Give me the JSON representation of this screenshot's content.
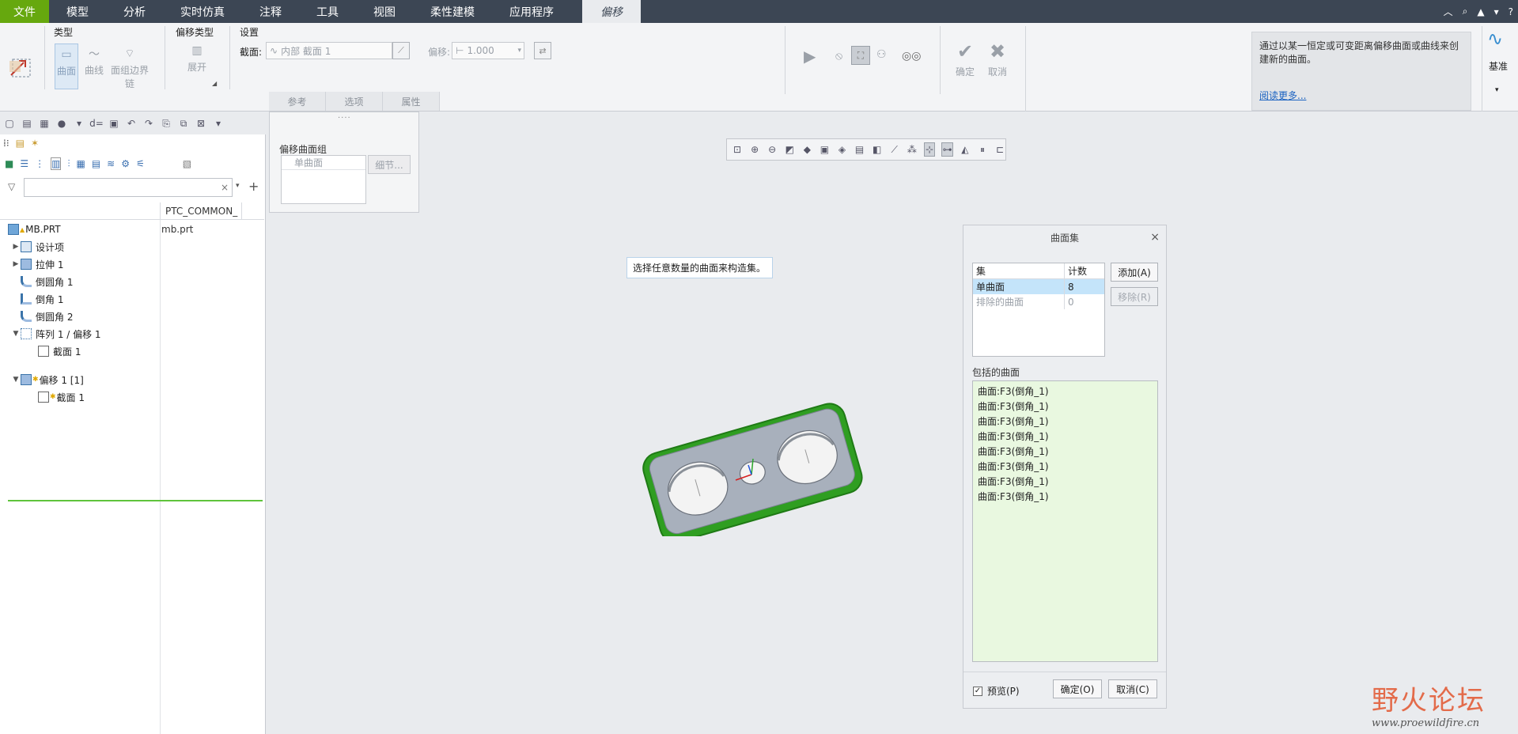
{
  "menubar": {
    "tabs": [
      "文件",
      "模型",
      "分析",
      "实时仿真",
      "注释",
      "工具",
      "视图",
      "柔性建模",
      "应用程序"
    ],
    "active_tab": "偏移",
    "right_icons": [
      "collapse-ribbon-icon",
      "search-icon",
      "graduation-cap-icon",
      "dropdown-icon",
      "help-icon"
    ]
  },
  "ribbon": {
    "type_group": {
      "title": "类型",
      "items": [
        "曲面",
        "曲线",
        "面组边界",
        "链"
      ]
    },
    "offset_type_group": {
      "title": "偏移类型",
      "item": "展开"
    },
    "settings_group": {
      "title": "设置",
      "section_label": "截面:",
      "section_value": "内部 截面 1",
      "offset_label": "偏移:",
      "offset_value": "1.000"
    },
    "subtabs": [
      "参考",
      "选项",
      "属性"
    ],
    "confirm_label": "确定",
    "cancel_label": "取消",
    "info_text": "通过以某一恒定或可变距离偏移曲面或曲线来创建新的曲面。",
    "info_link": "阅读更多...",
    "datum_label": "基准"
  },
  "offset_popover": {
    "title": "偏移曲面组",
    "list_header": "单曲面",
    "detail_button": "细节..."
  },
  "tree": {
    "column_header": "PTC_COMMON_",
    "rows": [
      {
        "label": "MB.PRT",
        "col2": "mb.prt"
      },
      {
        "label": "设计项"
      },
      {
        "label": "拉伸 1"
      },
      {
        "label": "倒圆角 1"
      },
      {
        "label": "倒角 1"
      },
      {
        "label": "倒圆角 2"
      },
      {
        "label": "阵列 1 / 偏移 1"
      },
      {
        "label": "截面 1"
      },
      {
        "label": "偏移 1 [1]"
      },
      {
        "label": "截面 1"
      }
    ]
  },
  "message_tip": "选择任意数量的曲面来构造集。",
  "dialog": {
    "title": "曲面集",
    "table_headers": [
      "集",
      "计数"
    ],
    "table_rows": [
      {
        "name": "单曲面",
        "count": "8"
      },
      {
        "name": "排除的曲面",
        "count": "0"
      }
    ],
    "add_button": "添加(A)",
    "remove_button": "移除(R)",
    "included_label": "包括的曲面",
    "included_items": [
      "曲面:F3(倒角_1)",
      "曲面:F3(倒角_1)",
      "曲面:F3(倒角_1)",
      "曲面:F3(倒角_1)",
      "曲面:F3(倒角_1)",
      "曲面:F3(倒角_1)",
      "曲面:F3(倒角_1)",
      "曲面:F3(倒角_1)"
    ],
    "preview_label": "预览(P)",
    "preview_checked": true,
    "ok_button": "确定(O)",
    "cancel_button": "取消(C)"
  },
  "watermark": {
    "title": "野火论坛",
    "url": "www.proewildfire.cn"
  },
  "colors": {
    "menubar": "#3c4654",
    "file_tab": "#66a80e",
    "selected_row": "#c4e4fa",
    "included_list_bg": "#e9f8e0",
    "model_edge_green": "#2f9e21",
    "model_face": "#a8b0bc"
  }
}
